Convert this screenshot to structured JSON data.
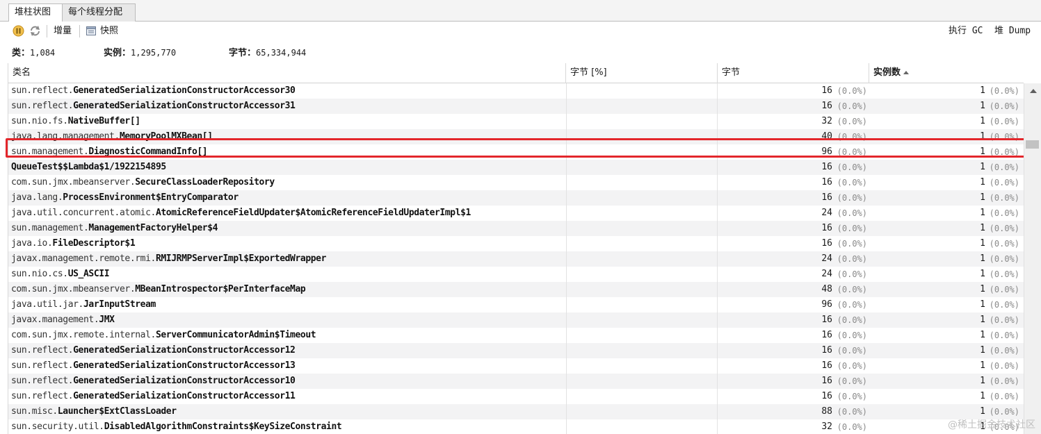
{
  "tabs": [
    "堆柱状图",
    "每个线程分配"
  ],
  "toolbar": {
    "delta_label": "增量",
    "snapshot_label": "快照",
    "run_gc_label": "执行 GC",
    "heap_dump_label": "堆 Dump"
  },
  "stats": {
    "classes_label": "类：",
    "classes_value": "1,084",
    "instances_label": "实例：",
    "instances_value": "1,295,770",
    "bytes_label": "字节：",
    "bytes_value": "65,334,944"
  },
  "table": {
    "headers": [
      "类名",
      "字节 [%]",
      "字节",
      "实例数"
    ],
    "sorted_column": "实例数",
    "rows": [
      {
        "pkg": "sun.reflect.",
        "cls": "GeneratedSerializationConstructorAccessor30",
        "bytes": "16",
        "bytes_pct": "(0.0%)",
        "instances": "1",
        "inst_pct": "(0.0%)"
      },
      {
        "pkg": "sun.reflect.",
        "cls": "GeneratedSerializationConstructorAccessor31",
        "bytes": "16",
        "bytes_pct": "(0.0%)",
        "instances": "1",
        "inst_pct": "(0.0%)"
      },
      {
        "pkg": "sun.nio.fs.",
        "cls": "NativeBuffer[]",
        "bytes": "32",
        "bytes_pct": "(0.0%)",
        "instances": "1",
        "inst_pct": "(0.0%)"
      },
      {
        "pkg": "java.lang.management.",
        "cls": "MemoryPoolMXBean[]",
        "bytes": "40",
        "bytes_pct": "(0.0%)",
        "instances": "1",
        "inst_pct": "(0.0%)"
      },
      {
        "pkg": "sun.management.",
        "cls": "DiagnosticCommandInfo[]",
        "bytes": "96",
        "bytes_pct": "(0.0%)",
        "instances": "1",
        "inst_pct": "(0.0%)"
      },
      {
        "pkg": "",
        "cls": "QueueTest$$Lambda$1/1922154895",
        "bytes": "16",
        "bytes_pct": "(0.0%)",
        "instances": "1",
        "inst_pct": "(0.0%)"
      },
      {
        "pkg": "com.sun.jmx.mbeanserver.",
        "cls": "SecureClassLoaderRepository",
        "bytes": "16",
        "bytes_pct": "(0.0%)",
        "instances": "1",
        "inst_pct": "(0.0%)"
      },
      {
        "pkg": "java.lang.",
        "cls": "ProcessEnvironment$EntryComparator",
        "bytes": "16",
        "bytes_pct": "(0.0%)",
        "instances": "1",
        "inst_pct": "(0.0%)"
      },
      {
        "pkg": "java.util.concurrent.atomic.",
        "cls": "AtomicReferenceFieldUpdater$AtomicReferenceFieldUpdaterImpl$1",
        "bytes": "24",
        "bytes_pct": "(0.0%)",
        "instances": "1",
        "inst_pct": "(0.0%)"
      },
      {
        "pkg": "sun.management.",
        "cls": "ManagementFactoryHelper$4",
        "bytes": "16",
        "bytes_pct": "(0.0%)",
        "instances": "1",
        "inst_pct": "(0.0%)"
      },
      {
        "pkg": "java.io.",
        "cls": "FileDescriptor$1",
        "bytes": "16",
        "bytes_pct": "(0.0%)",
        "instances": "1",
        "inst_pct": "(0.0%)"
      },
      {
        "pkg": "javax.management.remote.rmi.",
        "cls": "RMIJRMPServerImpl$ExportedWrapper",
        "bytes": "24",
        "bytes_pct": "(0.0%)",
        "instances": "1",
        "inst_pct": "(0.0%)"
      },
      {
        "pkg": "sun.nio.cs.",
        "cls": "US_ASCII",
        "bytes": "24",
        "bytes_pct": "(0.0%)",
        "instances": "1",
        "inst_pct": "(0.0%)"
      },
      {
        "pkg": "com.sun.jmx.mbeanserver.",
        "cls": "MBeanIntrospector$PerInterfaceMap",
        "bytes": "48",
        "bytes_pct": "(0.0%)",
        "instances": "1",
        "inst_pct": "(0.0%)"
      },
      {
        "pkg": "java.util.jar.",
        "cls": "JarInputStream",
        "bytes": "96",
        "bytes_pct": "(0.0%)",
        "instances": "1",
        "inst_pct": "(0.0%)"
      },
      {
        "pkg": "javax.management.",
        "cls": "JMX",
        "bytes": "16",
        "bytes_pct": "(0.0%)",
        "instances": "1",
        "inst_pct": "(0.0%)"
      },
      {
        "pkg": "com.sun.jmx.remote.internal.",
        "cls": "ServerCommunicatorAdmin$Timeout",
        "bytes": "16",
        "bytes_pct": "(0.0%)",
        "instances": "1",
        "inst_pct": "(0.0%)"
      },
      {
        "pkg": "sun.reflect.",
        "cls": "GeneratedSerializationConstructorAccessor12",
        "bytes": "16",
        "bytes_pct": "(0.0%)",
        "instances": "1",
        "inst_pct": "(0.0%)"
      },
      {
        "pkg": "sun.reflect.",
        "cls": "GeneratedSerializationConstructorAccessor13",
        "bytes": "16",
        "bytes_pct": "(0.0%)",
        "instances": "1",
        "inst_pct": "(0.0%)"
      },
      {
        "pkg": "sun.reflect.",
        "cls": "GeneratedSerializationConstructorAccessor10",
        "bytes": "16",
        "bytes_pct": "(0.0%)",
        "instances": "1",
        "inst_pct": "(0.0%)"
      },
      {
        "pkg": "sun.reflect.",
        "cls": "GeneratedSerializationConstructorAccessor11",
        "bytes": "16",
        "bytes_pct": "(0.0%)",
        "instances": "1",
        "inst_pct": "(0.0%)"
      },
      {
        "pkg": "sun.misc.",
        "cls": "Launcher$ExtClassLoader",
        "bytes": "88",
        "bytes_pct": "(0.0%)",
        "instances": "1",
        "inst_pct": "(0.0%)"
      },
      {
        "pkg": "sun.security.util.",
        "cls": "DisabledAlgorithmConstraints$KeySizeConstraint",
        "bytes": "32",
        "bytes_pct": "(0.0%)",
        "instances": "1",
        "inst_pct": "(0.0%)"
      }
    ]
  },
  "watermark": "@稀土掘金技术社区",
  "colors": {
    "highlight": "#e3262b",
    "alt_row": "#f3f3f4"
  }
}
